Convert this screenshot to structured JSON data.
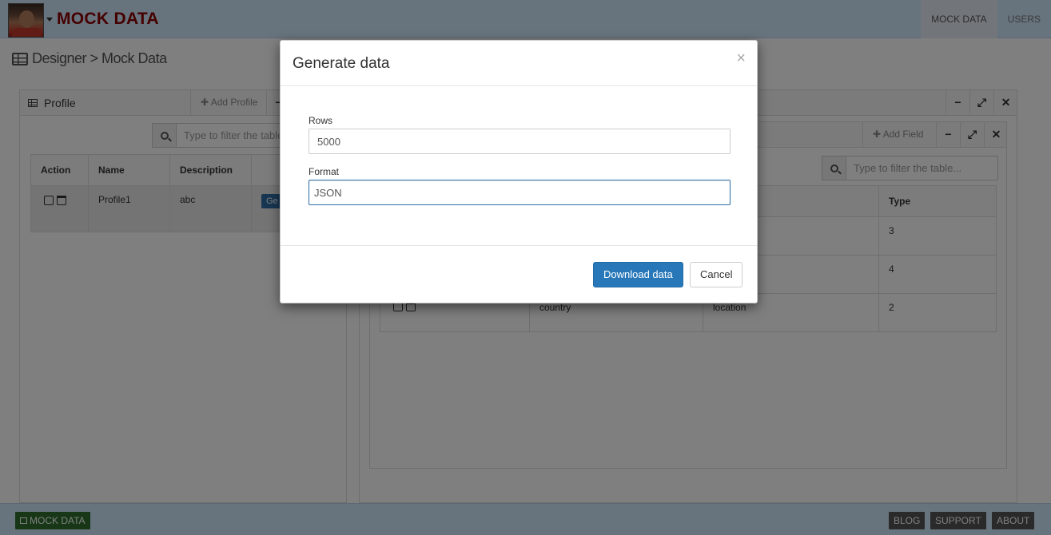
{
  "header": {
    "brand": "MOCK DATA",
    "nav": [
      {
        "label": "MOCK DATA",
        "active": true
      },
      {
        "label": "USERS",
        "active": false
      }
    ]
  },
  "breadcrumb": {
    "text": "Designer > Mock Data"
  },
  "profile_panel": {
    "title": "Profile",
    "add_button": "Add Profile",
    "filter_placeholder": "Type to filter the table...",
    "columns": [
      "Action",
      "Name",
      "Description"
    ],
    "rows": [
      {
        "name": "Profile1",
        "description": "abc",
        "button": "Ge"
      }
    ]
  },
  "fields_panel": {
    "add_button": "Add Field",
    "filter_placeholder": "Type to filter the table...",
    "type_column": "Type",
    "rows": [
      {
        "name": "",
        "category": "",
        "type": "3"
      },
      {
        "name": "",
        "category": "",
        "type": "4"
      },
      {
        "name": "country",
        "category": "location",
        "type": "2"
      }
    ]
  },
  "modal": {
    "title": "Generate data",
    "close": "×",
    "rows_label": "Rows",
    "rows_value": "5000",
    "format_label": "Format",
    "format_value": "JSON",
    "download_label": "Download data",
    "cancel_label": "Cancel"
  },
  "footer": {
    "left": "MOCK DATA",
    "links": [
      "BLOG",
      "SUPPORT",
      "ABOUT"
    ]
  },
  "colors": {
    "header_bg": "#cfe6fb",
    "brand": "#8b0000",
    "primary": "#2878b9",
    "footer_green": "#2f6e2f",
    "footer_grey": "#555555"
  }
}
